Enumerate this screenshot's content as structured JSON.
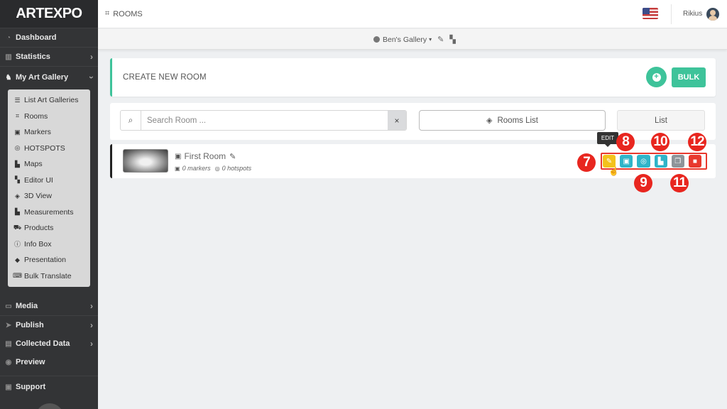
{
  "app": {
    "logo": "ARTEXPO"
  },
  "sidebar": {
    "items_top": [
      {
        "label": "Dashboard",
        "icon": "dashboard-icon"
      },
      {
        "label": "Statistics",
        "icon": "bar-chart-icon"
      },
      {
        "label": "My Art Gallery",
        "icon": "gallery-icon"
      }
    ],
    "submenu": [
      {
        "label": "List Art Galleries",
        "icon": "list-icon"
      },
      {
        "label": "Rooms",
        "icon": "crop-icon"
      },
      {
        "label": "Markers",
        "icon": "marker-icon"
      },
      {
        "label": "HOTSPOTS",
        "icon": "target-icon"
      },
      {
        "label": "Maps",
        "icon": "map-icon"
      },
      {
        "label": "Editor UI",
        "icon": "editor-icon"
      },
      {
        "label": "3D View",
        "icon": "cube-icon"
      },
      {
        "label": "Measurements",
        "icon": "ruler-icon"
      },
      {
        "label": "Products",
        "icon": "cart-icon"
      },
      {
        "label": "Info Box",
        "icon": "info-icon"
      },
      {
        "label": "Presentation",
        "icon": "presentation-icon"
      },
      {
        "label": "Bulk Translate",
        "icon": "translate-icon"
      }
    ],
    "items_bottom": [
      {
        "label": "Media",
        "icon": "monitor-icon"
      },
      {
        "label": "Publish",
        "icon": "send-icon"
      },
      {
        "label": "Collected Data",
        "icon": "database-icon"
      },
      {
        "label": "Preview",
        "icon": "eye-icon"
      },
      {
        "label": "Support",
        "icon": "support-icon"
      }
    ]
  },
  "topbar": {
    "breadcrumb": "ROOMS",
    "username": "Rikius"
  },
  "gallery_selector": {
    "selected": "Ben's Gallery"
  },
  "create_room": {
    "title": "CREATE NEW ROOM",
    "bulk_label": "BULK"
  },
  "search": {
    "placeholder": "Search Room ...",
    "clear": "×",
    "rooms_list_label": "Rooms List",
    "list_label": "List"
  },
  "room": {
    "name": "First Room",
    "markers": "0 markers",
    "hotspots": "0 hotspots"
  },
  "tooltip": "EDIT",
  "callouts": [
    "7",
    "8",
    "9",
    "10",
    "11",
    "12"
  ],
  "colors": {
    "accent_green": "#3ec39a",
    "sidebar_bg": "#333436",
    "edit_yellow": "#f3c21b",
    "action_teal": "#2fb4c8",
    "delete_red": "#e8382d",
    "callout_red": "#e8261f"
  }
}
